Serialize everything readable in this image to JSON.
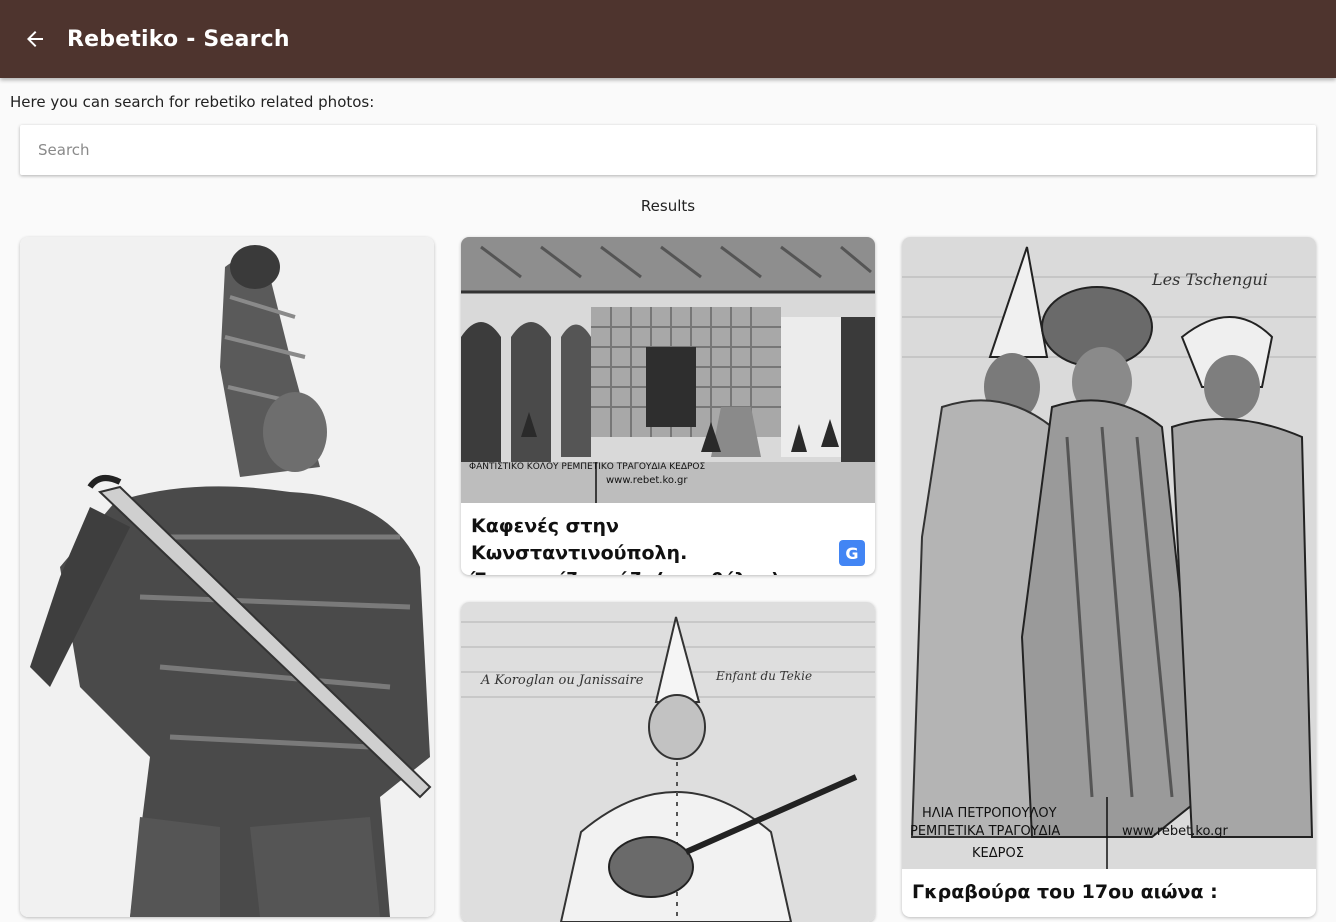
{
  "appbar": {
    "title": "Rebetiko - Search",
    "back_icon": "arrow-back-icon",
    "background": "#4e342e"
  },
  "intro": {
    "text": "Here you can search for rebetiko related photos:"
  },
  "search": {
    "placeholder": "Search",
    "value": ""
  },
  "results": {
    "label": "Results",
    "cards": [
      {
        "image": "engraving-figure-with-sword"
      },
      {
        "image": "engraving-cafe-constantinople",
        "watermark_left": "ΦΑΝΤΙΣΤΙΚΟ ΚΟΛΟΥ ΡΕΜΠΕΤΙΚΟ ΤΡΑΓΟΥΔΙΑ ΚΕΔΡΟΣ",
        "watermark_right": "www.rebet.ko.gr",
        "caption_line1": "Καφενές στην Κωνσταντινούπολη.",
        "caption_line2": "Ένας παίζει σάζι (στο βέλος)",
        "translate_icon": "google-translate-icon"
      },
      {
        "image": "engraving-saz-player",
        "inscription_left": "A Koroglan ou Janissaire",
        "inscription_right": "Enfant du Tekie"
      },
      {
        "image": "engraving-dervishes-dancing",
        "inscription": "Les Tschengui",
        "watermark_line1": "ΗΛΙΑ ΠΕΤΡΟΠΟΥΛΟΥ",
        "watermark_line2": "ΡΕΜΠΕΤΙΚΑ ΤΡΑΓΟΥΔΙΑ",
        "watermark_line3": "ΚΕΔΡΟΣ",
        "watermark_right": "www.rebet.ko.gr",
        "caption_line1": "Γκραβούρα του 17ου αιώνα :"
      }
    ]
  }
}
